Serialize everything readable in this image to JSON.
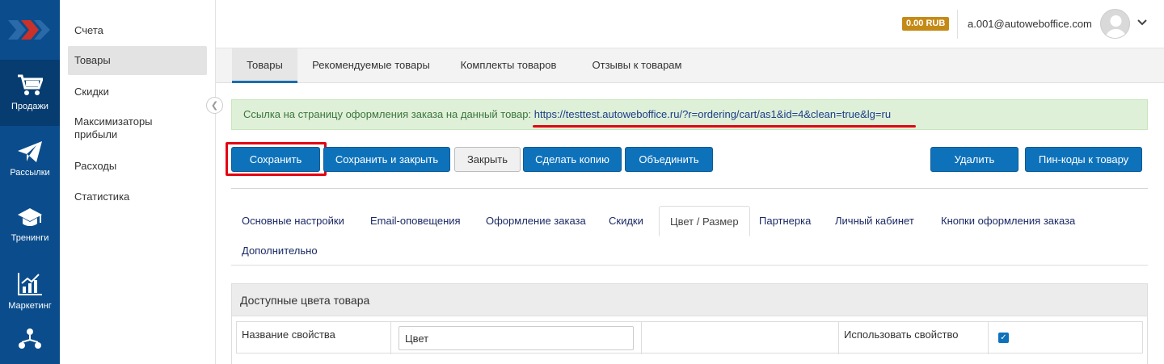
{
  "rail": {
    "items": [
      {
        "label": "Продажи",
        "icon": "cart-icon",
        "active": true
      },
      {
        "label": "Рассылки",
        "icon": "paper-plane-icon"
      },
      {
        "label": "Тренинги",
        "icon": "graduation-cap-icon"
      },
      {
        "label": "Маркетинг",
        "icon": "chart-growth-icon"
      },
      {
        "label": "",
        "icon": "network-icon"
      }
    ]
  },
  "submenu": {
    "items": [
      {
        "label": "Счета"
      },
      {
        "label": "Товары",
        "active": true
      },
      {
        "label": "Скидки"
      },
      {
        "label": "Максимизаторы прибыли"
      },
      {
        "label": "Расходы"
      },
      {
        "label": "Статистика"
      }
    ]
  },
  "header": {
    "balance": "0.00 RUB",
    "user_email": "a.001@autoweboffice.com"
  },
  "top_tabs": [
    {
      "label": "Товары",
      "active": true
    },
    {
      "label": "Рекомендуемые товары"
    },
    {
      "label": "Комплекты товаров"
    },
    {
      "label": "Отзывы к товарам"
    }
  ],
  "alert": {
    "text": "Ссылка на страницу оформления заказа на данный товар:",
    "link": "https://testtest.autoweboffice.ru/?r=ordering/cart/as1&id=4&clean=true&lg=ru"
  },
  "buttons": {
    "save": "Сохранить",
    "save_close": "Сохранить и закрыть",
    "close": "Закрыть",
    "copy": "Сделать копию",
    "merge": "Объединить",
    "delete": "Удалить",
    "pin_codes": "Пин-коды к товару"
  },
  "settings_tabs": [
    {
      "label": "Основные настройки"
    },
    {
      "label": "Email-оповещения"
    },
    {
      "label": "Оформление заказа"
    },
    {
      "label": "Скидки"
    },
    {
      "label": "Цвет / Размер",
      "active": true
    },
    {
      "label": "Партнерка"
    },
    {
      "label": "Личный кабинет"
    },
    {
      "label": "Кнопки оформления заказа"
    },
    {
      "label": "Дополнительно"
    }
  ],
  "panel": {
    "title": "Доступные цвета товара",
    "property_label": "Название свойства",
    "property_value": "Цвет",
    "use_label": "Использовать свойство",
    "use_checked": true
  },
  "colors": {
    "brand_dark": "#0b4d8c",
    "primary_button": "#0e72bb",
    "highlight_red": "#e30613",
    "balance_badge": "#c58a16"
  }
}
